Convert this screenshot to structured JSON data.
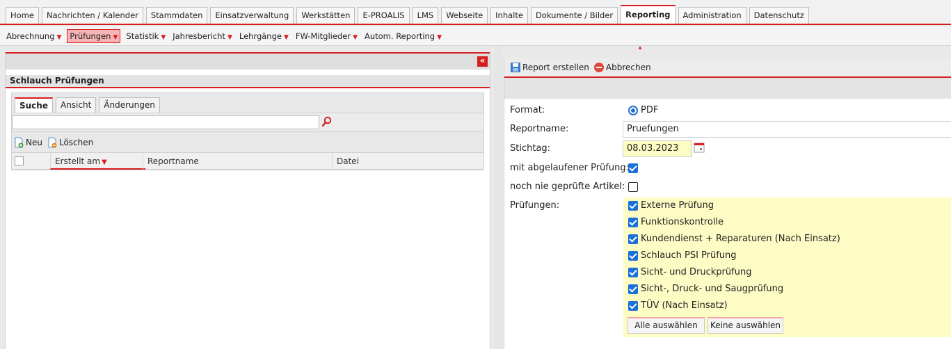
{
  "top_tabs": [
    "Home",
    "Nachrichten / Kalender",
    "Stammdaten",
    "Einsatzverwaltung",
    "Werkstätten",
    "E-PROALIS",
    "LMS",
    "Webseite",
    "Inhalte",
    "Dokumente / Bilder",
    "Reporting",
    "Administration",
    "Datenschutz"
  ],
  "sub_nav": [
    "Abrechnung",
    "Prüfungen",
    "Statistik",
    "Jahresbericht",
    "Lehrgänge",
    "FW-Mitglieder",
    "Autom. Reporting"
  ],
  "left": {
    "title": "Schlauch Prüfungen",
    "tabs": [
      "Suche",
      "Ansicht",
      "Änderungen"
    ],
    "search_value": "",
    "new_label": "Neu",
    "delete_label": "Löschen",
    "columns": [
      "Erstellt am",
      "Reportname",
      "Datei"
    ]
  },
  "right": {
    "create_label": "Report erstellen",
    "cancel_label": "Abbrechen",
    "format_label": "Format:",
    "format_value": "PDF",
    "reportname_label": "Reportname:",
    "reportname_value": "Pruefungen",
    "stichtag_label": "Stichtag:",
    "stichtag_value": "08.03.2023",
    "expired_label": "mit abgelaufener Prüfung:",
    "expired_checked": true,
    "never_label": "noch nie geprüfte Artikel:",
    "never_checked": false,
    "pruefungen_label": "Prüfungen:",
    "pruefungen": [
      {
        "label": "Externe Prüfung",
        "checked": true
      },
      {
        "label": "Funktionskontrolle",
        "checked": true
      },
      {
        "label": "Kundendienst + Reparaturen (Nach Einsatz)",
        "checked": true
      },
      {
        "label": "Schlauch PSI Prüfung",
        "checked": true
      },
      {
        "label": "Sicht- und Druckprüfung",
        "checked": true
      },
      {
        "label": "Sicht-, Druck- und Saugprüfung",
        "checked": true
      },
      {
        "label": "TÜV (Nach Einsatz)",
        "checked": true
      }
    ],
    "select_all_label": "Alle auswählen",
    "select_none_label": "Keine auswählen"
  },
  "colors": {
    "accent": "#d51e1e",
    "checkbox": "#1a6fd8",
    "highlight": "#fdfcc5"
  }
}
